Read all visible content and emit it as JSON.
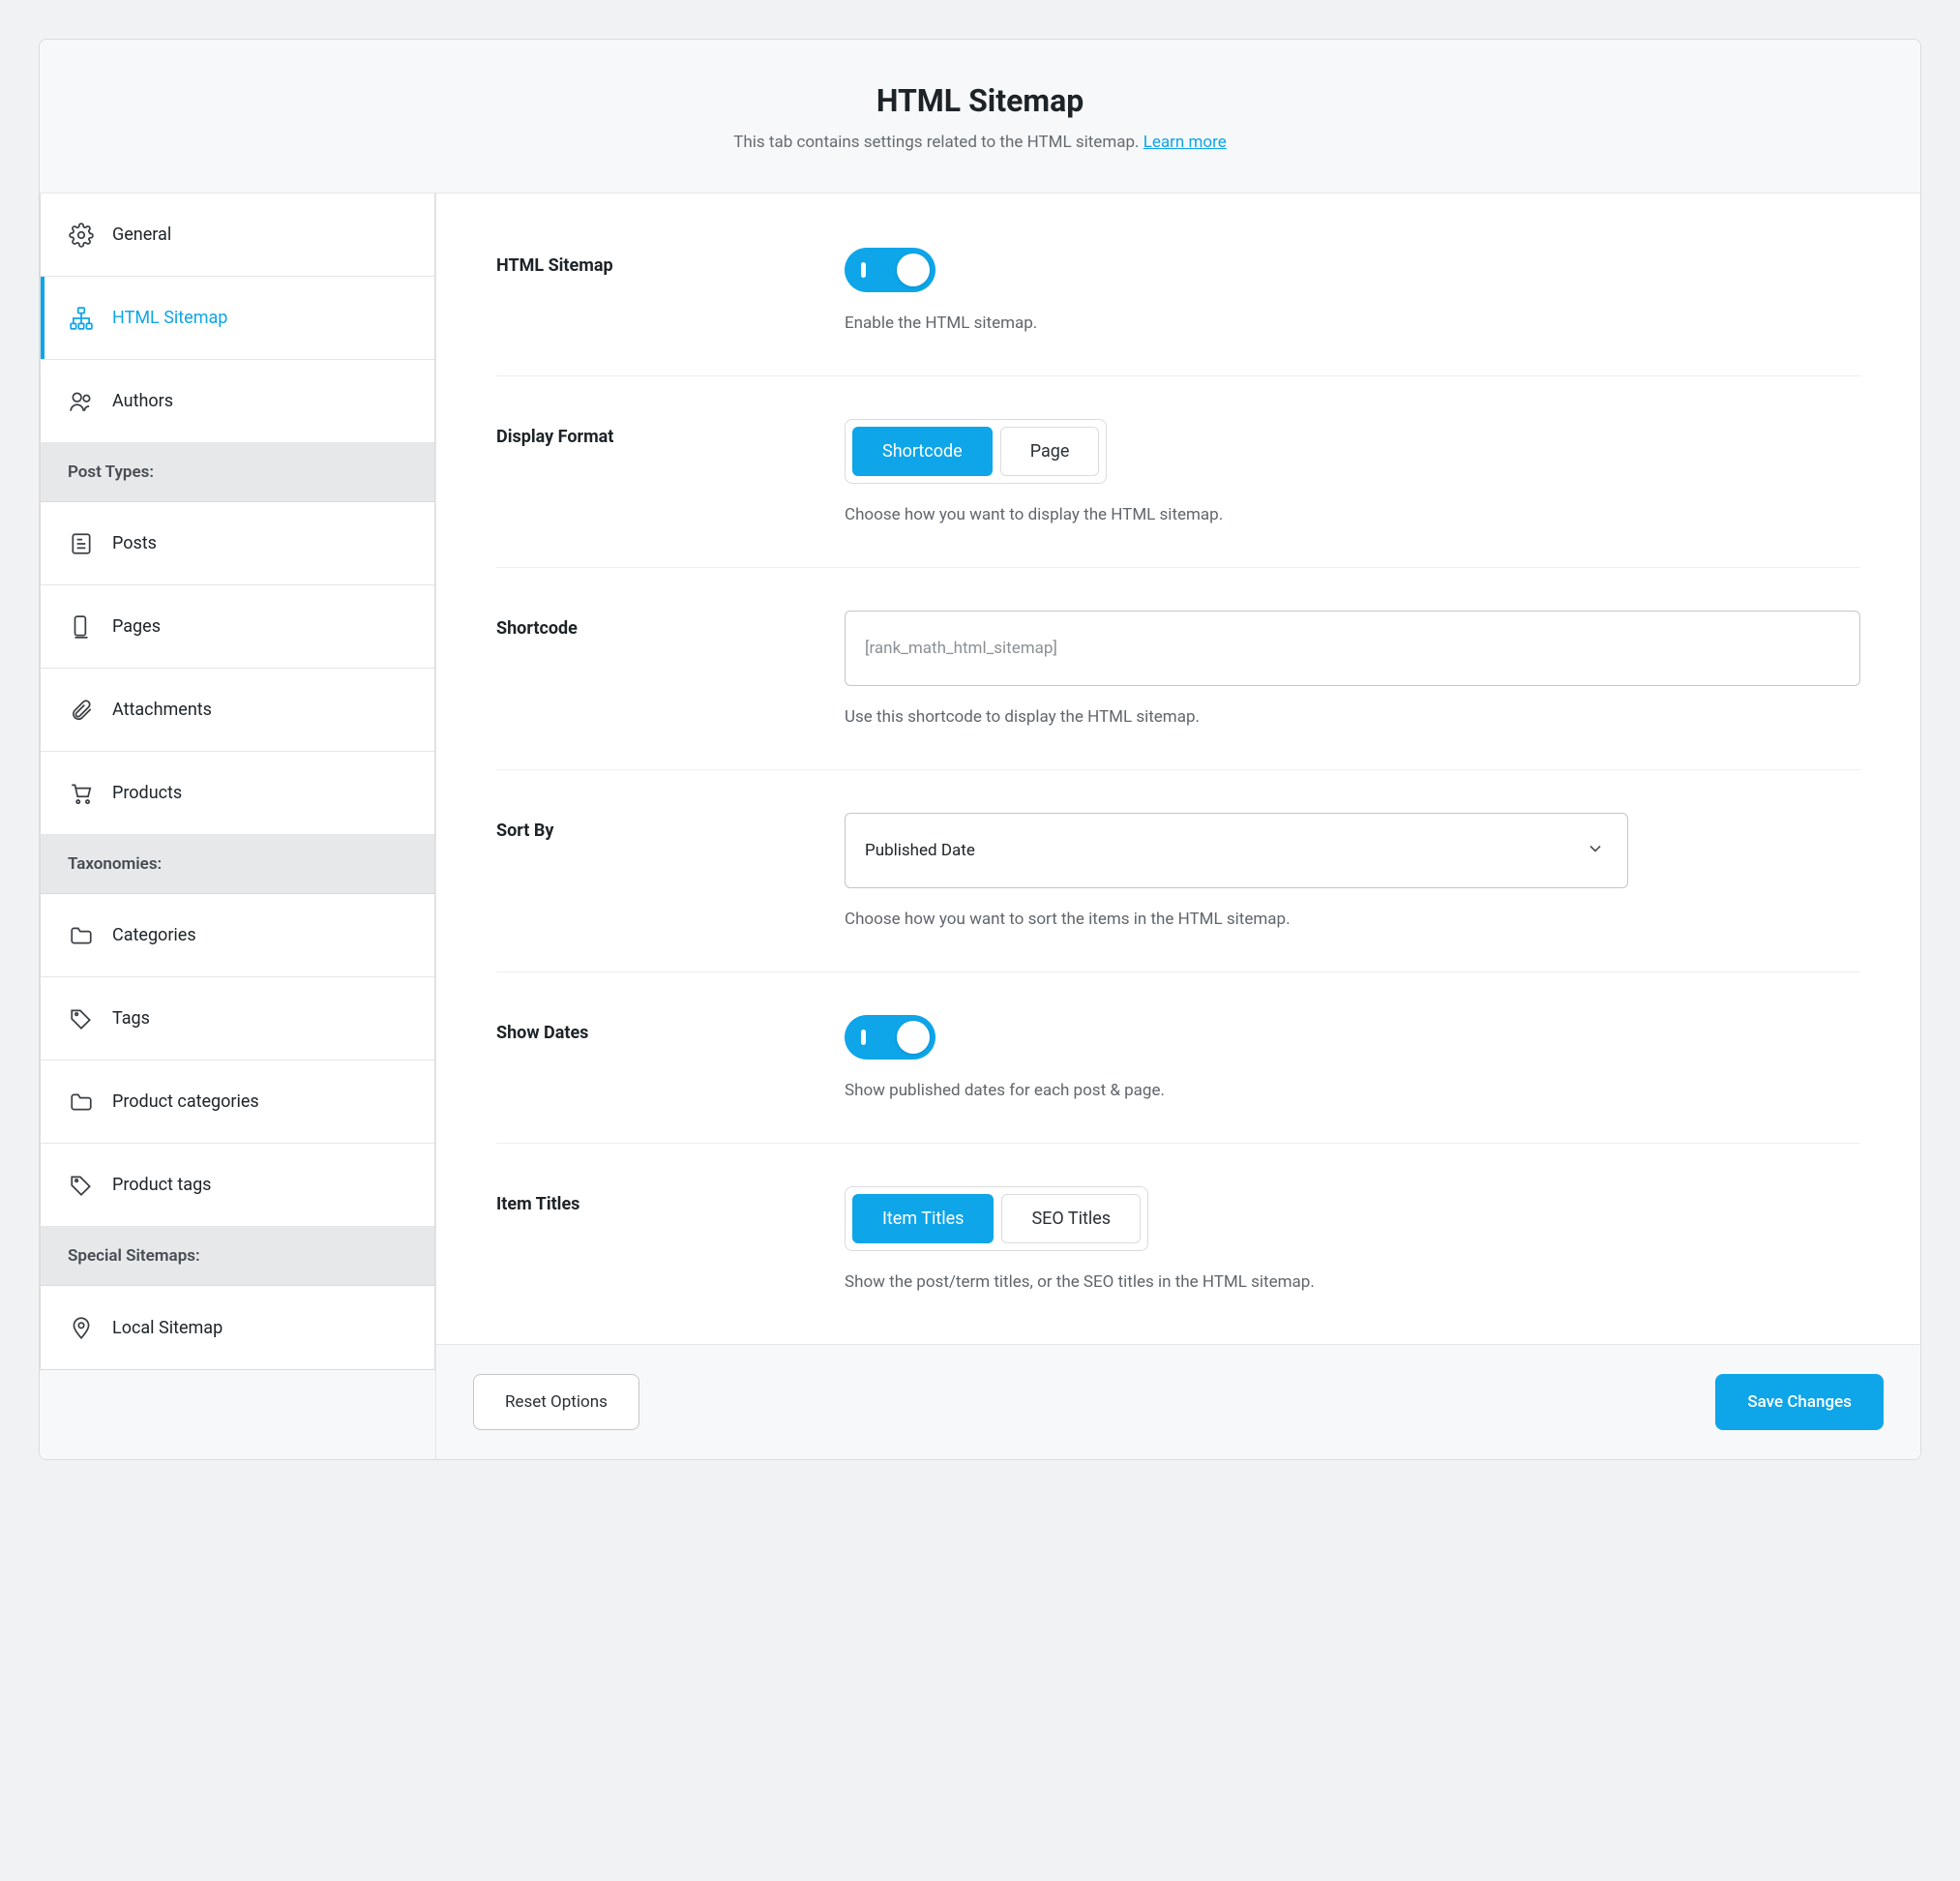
{
  "header": {
    "title": "HTML Sitemap",
    "subtitle": "This tab contains settings related to the HTML sitemap.",
    "learn_more": "Learn more"
  },
  "sidebar": {
    "items_top": [
      {
        "id": "general",
        "label": "General",
        "icon": "gear"
      },
      {
        "id": "html-sitemap",
        "label": "HTML Sitemap",
        "icon": "sitemap",
        "active": true
      },
      {
        "id": "authors",
        "label": "Authors",
        "icon": "users"
      }
    ],
    "group_post_types": "Post Types:",
    "items_post_types": [
      {
        "id": "posts",
        "label": "Posts",
        "icon": "post"
      },
      {
        "id": "pages",
        "label": "Pages",
        "icon": "page"
      },
      {
        "id": "attachments",
        "label": "Attachments",
        "icon": "clip"
      },
      {
        "id": "products",
        "label": "Products",
        "icon": "cart"
      }
    ],
    "group_taxonomies": "Taxonomies:",
    "items_taxonomies": [
      {
        "id": "categories",
        "label": "Categories",
        "icon": "folder"
      },
      {
        "id": "tags",
        "label": "Tags",
        "icon": "tag"
      },
      {
        "id": "product-categories",
        "label": "Product categories",
        "icon": "folder"
      },
      {
        "id": "product-tags",
        "label": "Product tags",
        "icon": "tag"
      }
    ],
    "group_special": "Special Sitemaps:",
    "items_special": [
      {
        "id": "local-sitemap",
        "label": "Local Sitemap",
        "icon": "pin"
      }
    ]
  },
  "settings": {
    "html_sitemap": {
      "label": "HTML Sitemap",
      "desc": "Enable the HTML sitemap.",
      "enabled": true
    },
    "display_format": {
      "label": "Display Format",
      "options": [
        "Shortcode",
        "Page"
      ],
      "selected": "Shortcode",
      "desc": "Choose how you want to display the HTML sitemap."
    },
    "shortcode": {
      "label": "Shortcode",
      "placeholder": "[rank_math_html_sitemap]",
      "value": "",
      "desc": "Use this shortcode to display the HTML sitemap."
    },
    "sort_by": {
      "label": "Sort By",
      "selected": "Published Date",
      "desc": "Choose how you want to sort the items in the HTML sitemap."
    },
    "show_dates": {
      "label": "Show Dates",
      "enabled": true,
      "desc": "Show published dates for each post & page."
    },
    "item_titles": {
      "label": "Item Titles",
      "options": [
        "Item Titles",
        "SEO Titles"
      ],
      "selected": "Item Titles",
      "desc": "Show the post/term titles, or the SEO titles in the HTML sitemap."
    }
  },
  "footer": {
    "reset": "Reset Options",
    "save": "Save Changes"
  }
}
